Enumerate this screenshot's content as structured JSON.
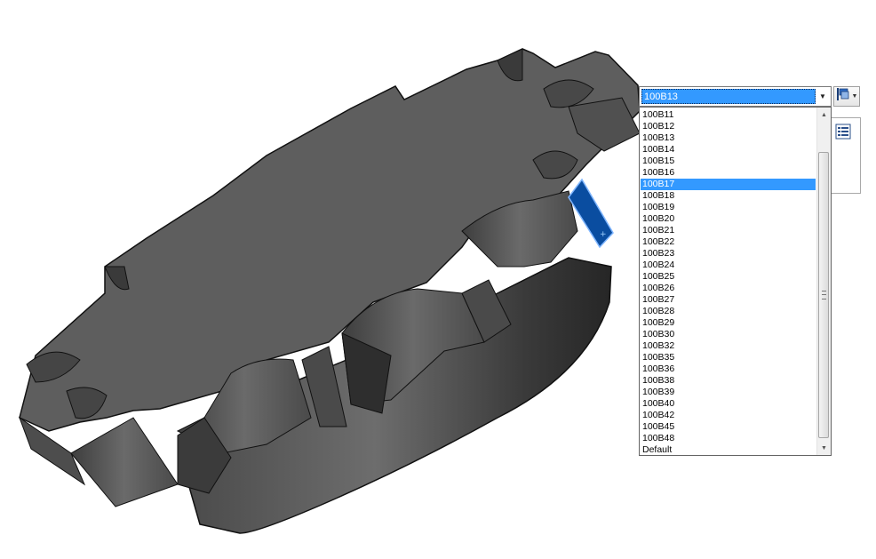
{
  "combo": {
    "selected_value": "100B13"
  },
  "dropdown": {
    "items": [
      "100B11",
      "100B12",
      "100B13",
      "100B14",
      "100B15",
      "100B16",
      "100B17",
      "100B18",
      "100B19",
      "100B20",
      "100B21",
      "100B22",
      "100B23",
      "100B24",
      "100B25",
      "100B26",
      "100B27",
      "100B28",
      "100B29",
      "100B30",
      "100B32",
      "100B35",
      "100B36",
      "100B38",
      "100B39",
      "100B40",
      "100B42",
      "100B45",
      "100B48",
      "Default"
    ],
    "highlighted_item": "100B17"
  },
  "icons": {
    "combo_arrow": "triangle-down-icon",
    "tool_button": "configuration-flag-icon",
    "side_panel": "list-view-icon",
    "scroll_up": "scroll-up-arrow-icon",
    "scroll_down": "scroll-down-arrow-icon"
  },
  "colors": {
    "selection": "#3399ff",
    "face_highlight": "#0a4da0",
    "model_gray": "#5f5f5f"
  }
}
